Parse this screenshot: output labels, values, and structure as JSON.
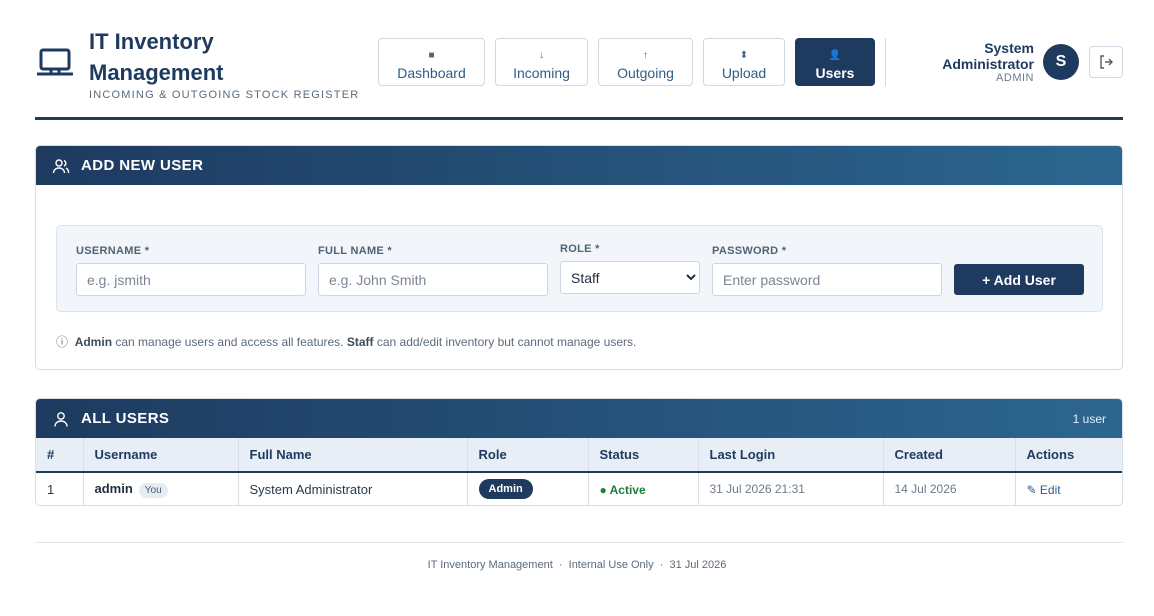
{
  "header": {
    "title": "IT Inventory Management",
    "subtitle": "INCOMING & OUTGOING STOCK REGISTER",
    "brand_icon": "laptop-icon"
  },
  "nav": {
    "items": [
      {
        "label": "Dashboard",
        "icon": "■",
        "active": false
      },
      {
        "label": "Incoming",
        "icon": "↓",
        "active": false
      },
      {
        "label": "Outgoing",
        "icon": "↑",
        "active": false
      },
      {
        "label": "Upload",
        "icon": "⬍",
        "active": false
      },
      {
        "label": "Users",
        "icon": "👤",
        "active": true
      }
    ]
  },
  "user": {
    "name": "System Administrator",
    "role": "ADMIN",
    "avatar_letter": "S"
  },
  "add_user": {
    "title": "ADD NEW USER",
    "username_label": "USERNAME *",
    "username_placeholder": "e.g. jsmith",
    "fullname_label": "FULL NAME *",
    "fullname_placeholder": "e.g. John Smith",
    "role_label": "ROLE *",
    "role_selected": "Staff",
    "password_label": "PASSWORD *",
    "password_placeholder": "Enter password",
    "add_button": "+ Add User",
    "info_admin": "Admin",
    "info_mid": " can manage users and access all features. ",
    "info_staff": "Staff",
    "info_end": " can add/edit inventory but cannot manage users."
  },
  "all_users": {
    "title": "ALL USERS",
    "count": "1 user",
    "columns": [
      "#",
      "Username",
      "Full Name",
      "Role",
      "Status",
      "Last Login",
      "Created",
      "Actions"
    ],
    "rows": [
      {
        "num": "1",
        "username": "admin",
        "you": "You",
        "full_name": "System Administrator",
        "role": "Admin",
        "status": "● Active",
        "last_login": "31 Jul 2026 21:31",
        "created": "14 Jul 2026",
        "action": "✎ Edit"
      }
    ]
  },
  "footer": {
    "text": "IT Inventory Management  ·  Internal Use Only  ·  31 Jul 2026"
  },
  "colors": {
    "primary": "#1e3a5f",
    "accent": "#2c6690",
    "success": "#1e7d3a"
  }
}
